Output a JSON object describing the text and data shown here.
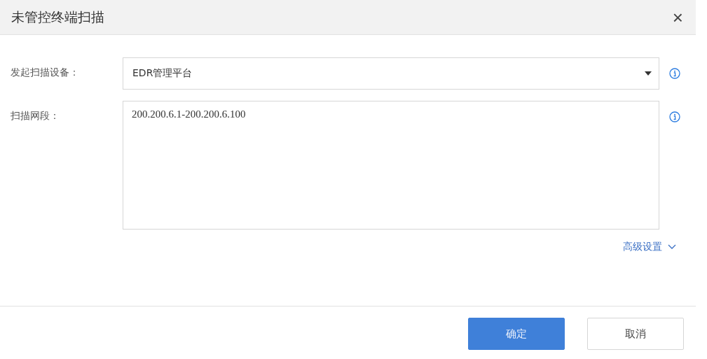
{
  "dialog": {
    "title": "未管控终端扫描",
    "close": "×"
  },
  "fields": [
    {
      "kind": "select",
      "label": "发起扫描设备：",
      "value": "EDR管理平台"
    },
    {
      "kind": "textarea",
      "label": "扫描网段：",
      "value": "200.200.6.1-200.200.6.100"
    }
  ],
  "advanced": {
    "label": "高级设置",
    "expanded": false
  },
  "buttons": [
    {
      "label": "确定",
      "kind": "primary"
    },
    {
      "label": "取消",
      "kind": "secondary"
    }
  ]
}
